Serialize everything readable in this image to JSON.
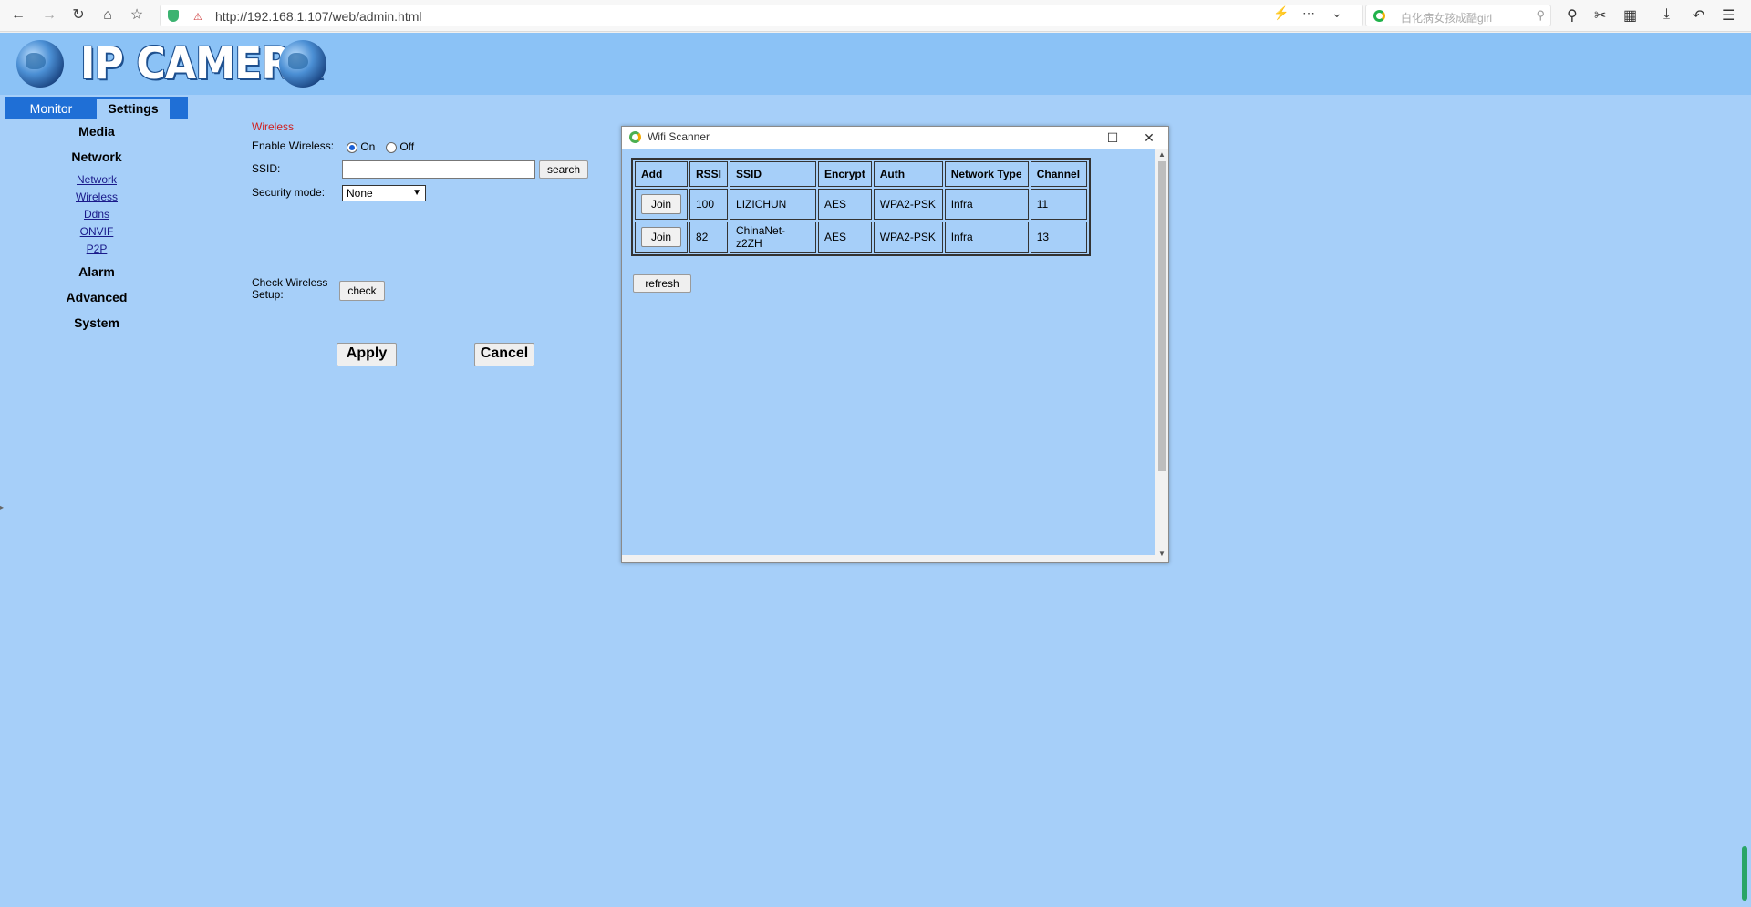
{
  "browser": {
    "url": "http://192.168.1.107/web/admin.html",
    "search_placeholder": "白化病女孩成酷girl"
  },
  "header": {
    "logo_text": "IP CAMERA"
  },
  "sidebar": {
    "tabs": [
      "Monitor",
      "Settings"
    ],
    "sections": [
      "Media",
      "Network",
      "Alarm",
      "Advanced",
      "System"
    ],
    "network_links": [
      "Network",
      "Wireless",
      "Ddns",
      "ONVIF",
      "P2P"
    ]
  },
  "wireless": {
    "title": "Wireless",
    "enable_label": "Enable Wireless:",
    "on_label": "On",
    "off_label": "Off",
    "ssid_label": "SSID:",
    "ssid_value": "",
    "search_label": "search",
    "security_label": "Security mode:",
    "security_value": "None",
    "check_label_1": "Check Wireless",
    "check_label_2": "Setup:",
    "check_button": "check",
    "apply": "Apply",
    "cancel": "Cancel"
  },
  "scanner": {
    "title": "Wifi Scanner",
    "headers": [
      "Add",
      "RSSI",
      "SSID",
      "Encrypt",
      "Auth",
      "Network Type",
      "Channel"
    ],
    "join_label": "Join",
    "rows": [
      {
        "rssi": "100",
        "ssid": "LIZICHUN",
        "encrypt": "AES",
        "auth": "WPA2-PSK",
        "type": "Infra",
        "channel": "11"
      },
      {
        "rssi": "82",
        "ssid": "ChinaNet-z2ZH",
        "encrypt": "AES",
        "auth": "WPA2-PSK",
        "type": "Infra",
        "channel": "13"
      }
    ],
    "refresh_label": "refresh"
  }
}
